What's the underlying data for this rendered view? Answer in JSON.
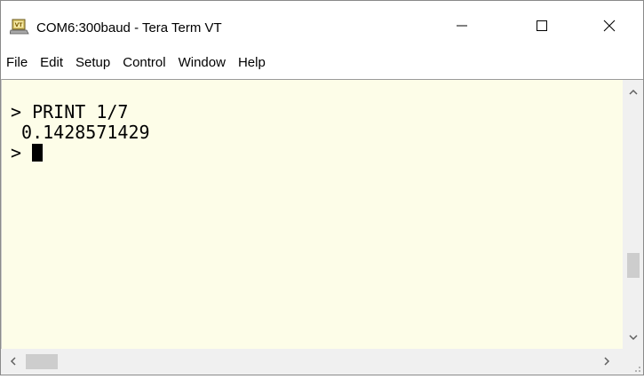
{
  "window": {
    "title": "COM6:300baud - Tera Term VT",
    "icon": "tera-term-vt-icon"
  },
  "controls": {
    "minimize_icon": "minimize-icon",
    "maximize_icon": "maximize-icon",
    "close_icon": "close-icon"
  },
  "menu": {
    "items": [
      {
        "label": "File"
      },
      {
        "label": "Edit"
      },
      {
        "label": "Setup"
      },
      {
        "label": "Control"
      },
      {
        "label": "Window"
      },
      {
        "label": "Help"
      }
    ]
  },
  "terminal": {
    "lines": [
      "> PRINT 1/7",
      " 0.1428571429",
      "> "
    ],
    "background": "#fdfde8",
    "foreground": "#000000"
  },
  "scrollbars": {
    "vertical_thumb_position": 0.65,
    "horizontal_thumb_position": 0.0
  }
}
